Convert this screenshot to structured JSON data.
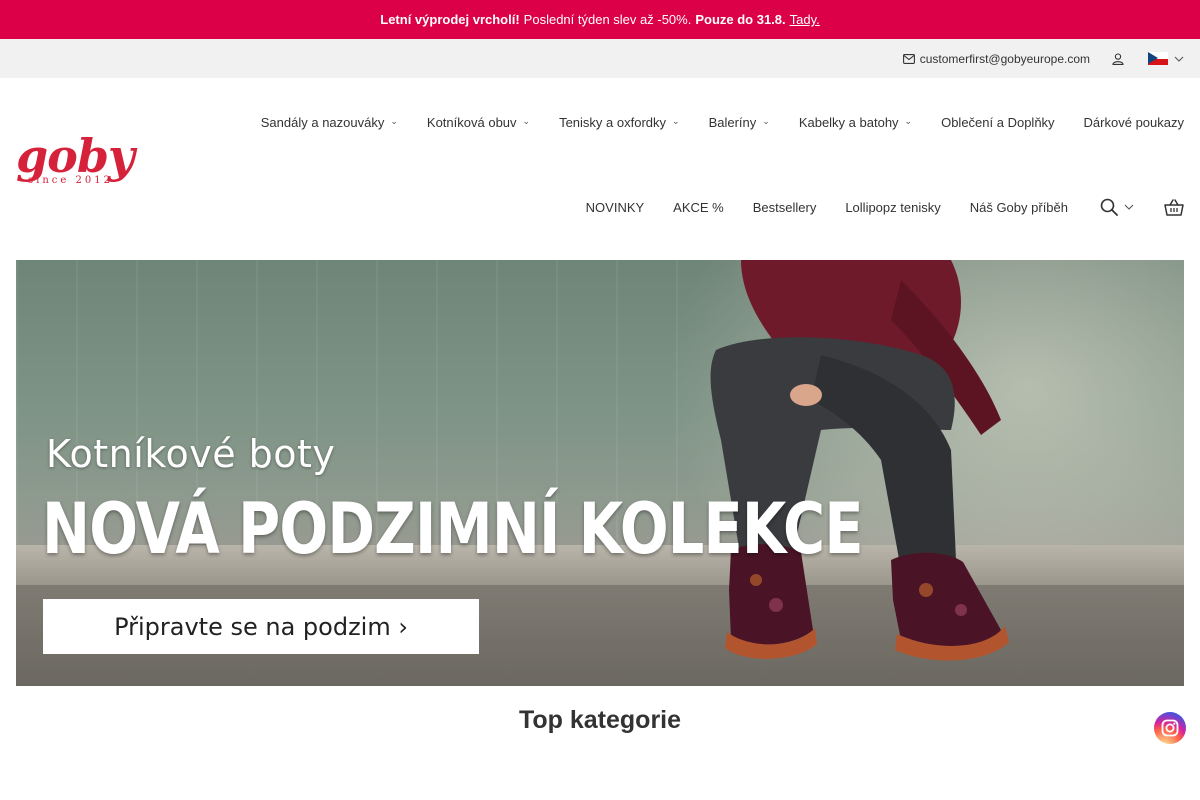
{
  "promo": {
    "bold1": "Letní výprodej vrcholí!",
    "text": "Poslední týden slev až -50%.",
    "bold2": "Pouze do 31.8.",
    "link": "Tady."
  },
  "util": {
    "email": "customerfirst@gobyeurope.com",
    "user_icon": "user-icon",
    "language_flag": "czech-flag"
  },
  "logo": {
    "word": "goby",
    "since": "since 2012"
  },
  "nav_primary": [
    {
      "label": "Sandály a nazouváky",
      "has_dropdown": true
    },
    {
      "label": "Kotníková obuv",
      "has_dropdown": true
    },
    {
      "label": "Tenisky a oxfordky",
      "has_dropdown": true
    },
    {
      "label": "Baleríny",
      "has_dropdown": true
    },
    {
      "label": "Kabelky a batohy",
      "has_dropdown": true
    },
    {
      "label": "Oblečení a Doplňky",
      "has_dropdown": false
    },
    {
      "label": "Dárkové poukazy",
      "has_dropdown": false
    }
  ],
  "nav_secondary": [
    {
      "label": "NOVINKY"
    },
    {
      "label": "AKCE %"
    },
    {
      "label": "Bestsellery"
    },
    {
      "label": "Lollipopz tenisky"
    },
    {
      "label": "Náš Goby příběh"
    }
  ],
  "hero": {
    "subtitle": "Kotníkové boty",
    "title": "NOVÁ PODZIMNÍ KOLEKCE",
    "cta": "Připravte se na podzim ›"
  },
  "section": {
    "title": "Top kategorie"
  },
  "colors": {
    "accent": "#dc0048",
    "brand": "#d6213b",
    "util_bg": "#f1f1f1"
  }
}
